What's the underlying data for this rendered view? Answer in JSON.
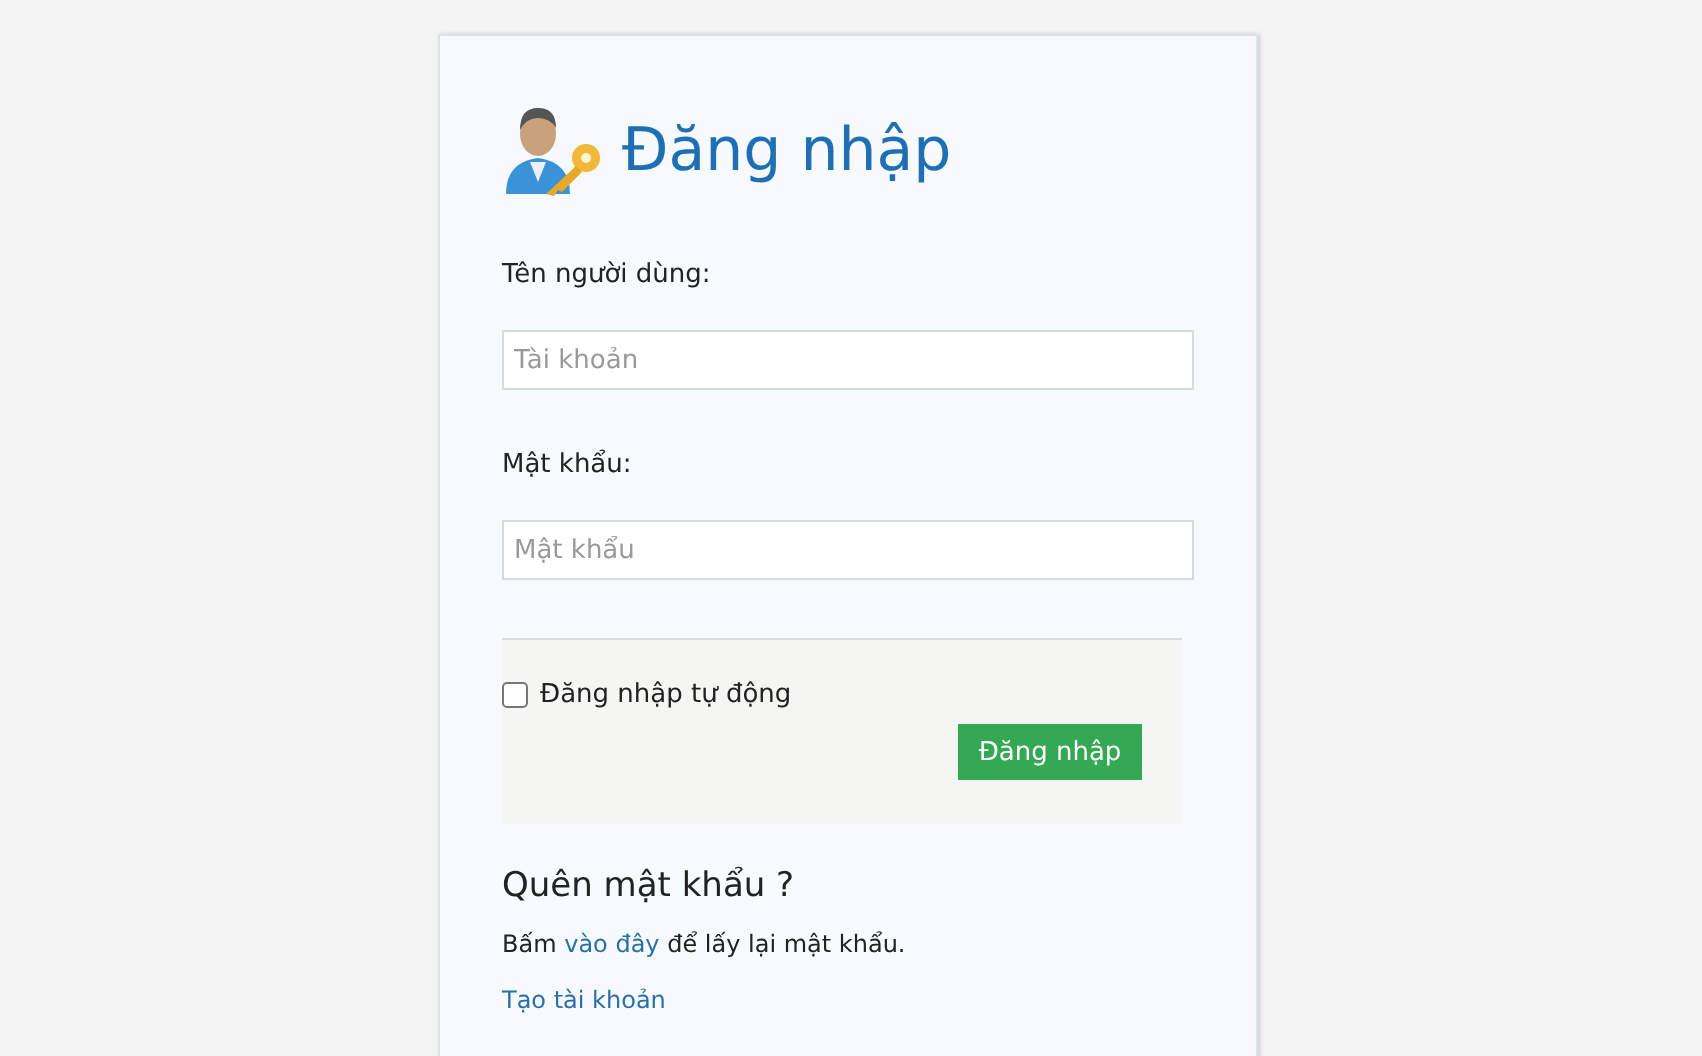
{
  "title": "Đăng nhập",
  "fields": [
    {
      "label": "Tên người dùng:",
      "placeholder": "Tài khoản"
    },
    {
      "label": "Mật khẩu:",
      "placeholder": "Mật khẩu"
    }
  ],
  "remember": {
    "label": "Đăng nhập tự động",
    "checked": false
  },
  "submit": "Đăng nhập",
  "forgot": {
    "heading": "Quên mật khẩu ?",
    "before": "Bấm ",
    "link": "vào đây",
    "after": " để lấy lại mật khẩu."
  },
  "create_account": "Tạo tài khoản"
}
